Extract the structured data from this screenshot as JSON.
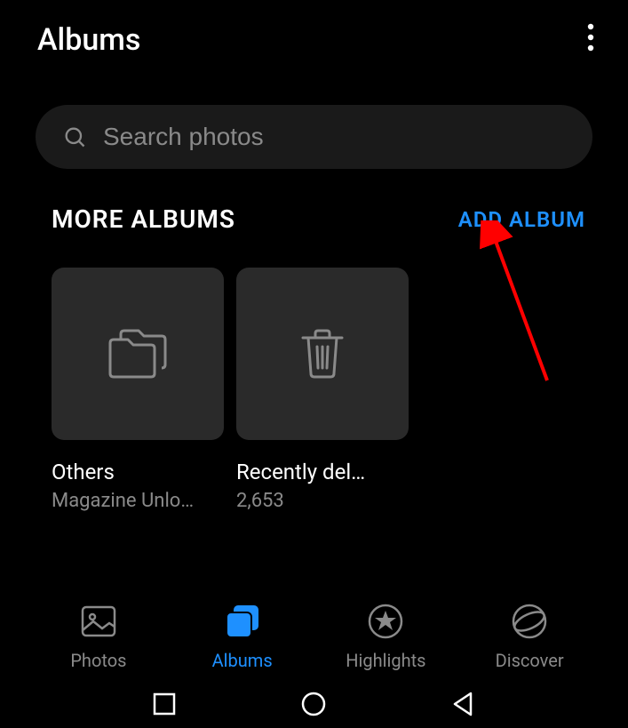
{
  "header": {
    "title": "Albums"
  },
  "search": {
    "placeholder": "Search photos"
  },
  "section": {
    "title": "MORE ALBUMS",
    "add_label": "ADD ALBUM"
  },
  "albums": [
    {
      "title": "Others",
      "subtitle": "Magazine Unlo…",
      "icon": "folder"
    },
    {
      "title": "Recently del…",
      "subtitle": "2,653",
      "icon": "trash"
    }
  ],
  "tabs": [
    {
      "label": "Photos",
      "icon": "photos",
      "active": false
    },
    {
      "label": "Albums",
      "icon": "albums",
      "active": true
    },
    {
      "label": "Highlights",
      "icon": "highlights",
      "active": false
    },
    {
      "label": "Discover",
      "icon": "discover",
      "active": false
    }
  ],
  "colors": {
    "accent": "#1e90ff",
    "annotation": "#ff0000"
  }
}
